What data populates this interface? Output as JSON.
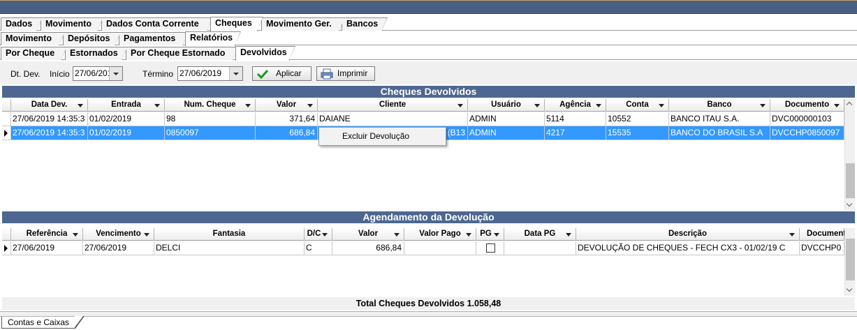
{
  "tabs_main": [
    "Dados",
    "Movimento",
    "Dados Conta Corrente",
    "Cheques",
    "Movimento Ger.",
    "Bancos"
  ],
  "tabs_sub": [
    "Movimento",
    "Depósitos",
    "Pagamentos",
    "Relatórios"
  ],
  "tabs_cheques": [
    "Por Cheque",
    "Estornados",
    "Por Cheque Estornado",
    "Devolvidos"
  ],
  "filter": {
    "label": "Dt. Dev.",
    "inicio_label": "Início",
    "inicio_value": "27/06/2019",
    "termino_label": "Término",
    "termino_value": "27/06/2019",
    "aplicar": "Aplicar",
    "imprimir": "Imprimir"
  },
  "devolvidos": {
    "title": "Cheques Devolvidos",
    "columns": [
      "Data Dev.",
      "Entrada",
      "Num. Cheque",
      "Valor",
      "Cliente",
      "Usuário",
      "Agência",
      "Conta",
      "Banco",
      "Documento"
    ],
    "rows": [
      [
        "27/06/2019 14:35:3",
        "01/02/2019",
        "98",
        "371,64",
        "DAIANE",
        "ADMIN",
        "5114",
        "10552",
        "BANCO ITAU S.A.",
        "DVC000000103"
      ],
      [
        "27/06/2019 14:35:3",
        "01/02/2019",
        "0850097",
        "686,84",
        "(B13",
        "ADMIN",
        "4217",
        "15535",
        "BANCO DO BRASIL S.A",
        "DVCCHP0850097"
      ]
    ]
  },
  "context_menu": {
    "item": "Excluir Devolução"
  },
  "agendamento": {
    "title": "Agendamento da Devolução",
    "columns": [
      "Referência",
      "Vencimento",
      "Fantasia",
      "D/C",
      "Valor",
      "Valor Pago",
      "PG",
      "Data PG",
      "Descrição",
      "Document"
    ],
    "rows": [
      [
        "27/06/2019",
        "27/06/2019",
        "DELCI",
        "C",
        "686,84",
        "",
        "",
        "",
        "DEVOLUÇÃO DE CHEQUES - FECH CX3 - 01/02/19 C",
        "DVCCHP0"
      ]
    ]
  },
  "total": "Total Cheques Devolvidos 1.058,48",
  "bottom_tab": "Contas e Caixas"
}
